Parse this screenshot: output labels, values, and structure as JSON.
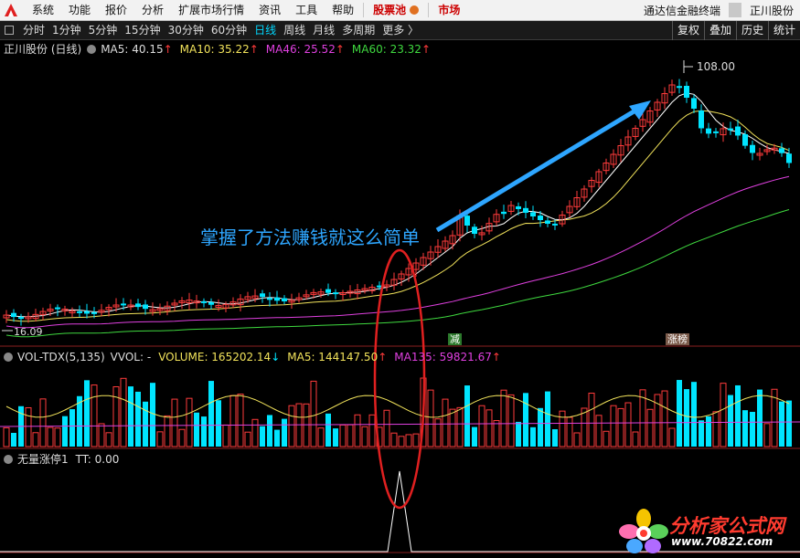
{
  "menu": {
    "items": [
      "系统",
      "功能",
      "报价",
      "分析",
      "扩展市场行情",
      "资讯",
      "工具",
      "帮助"
    ],
    "stock_pool": "股票池",
    "market": "市场",
    "app_name": "通达信金融终端",
    "stock_name": "正川股份"
  },
  "periods": {
    "items": [
      "分时",
      "1分钟",
      "5分钟",
      "15分钟",
      "30分钟",
      "60分钟",
      "日线",
      "周线",
      "月线",
      "多周期",
      "更多 〉"
    ],
    "active_index": 6,
    "right_buttons": [
      "复权",
      "叠加",
      "历史",
      "统计"
    ]
  },
  "price_panel": {
    "title": "正川股份 (日线)",
    "ma5": "MA5: 40.15",
    "ma10": "MA10: 35.22",
    "ma46": "MA46: 25.52",
    "ma60": "MA60: 23.32",
    "high_label": "108.00",
    "low_label": "16.09",
    "tag_jian": "减",
    "tag_zhangbang": "涨榜",
    "annotation": "掌握了方法赚钱就这么简单"
  },
  "volume_panel": {
    "title": "VOL-TDX(5,135)",
    "vvol": "VVOL: -",
    "volume": "VOLUME: 165202.14",
    "ma5": "MA5: 144147.50",
    "ma135": "MA135: 59821.67"
  },
  "signal_panel": {
    "title": "无量涨停1",
    "tt": "TT: 0.00"
  },
  "watermark": {
    "text": "分析家公式网",
    "url": "www.70822.com"
  },
  "colors": {
    "up": "#ff3b3b",
    "down": "#00e5ff",
    "ma5": "#ffffff",
    "ma10": "#f2e35b",
    "ma46": "#e040e0",
    "ma60": "#3fd93f",
    "annotation": "#2ea6ff",
    "circle": "#e02020"
  }
}
